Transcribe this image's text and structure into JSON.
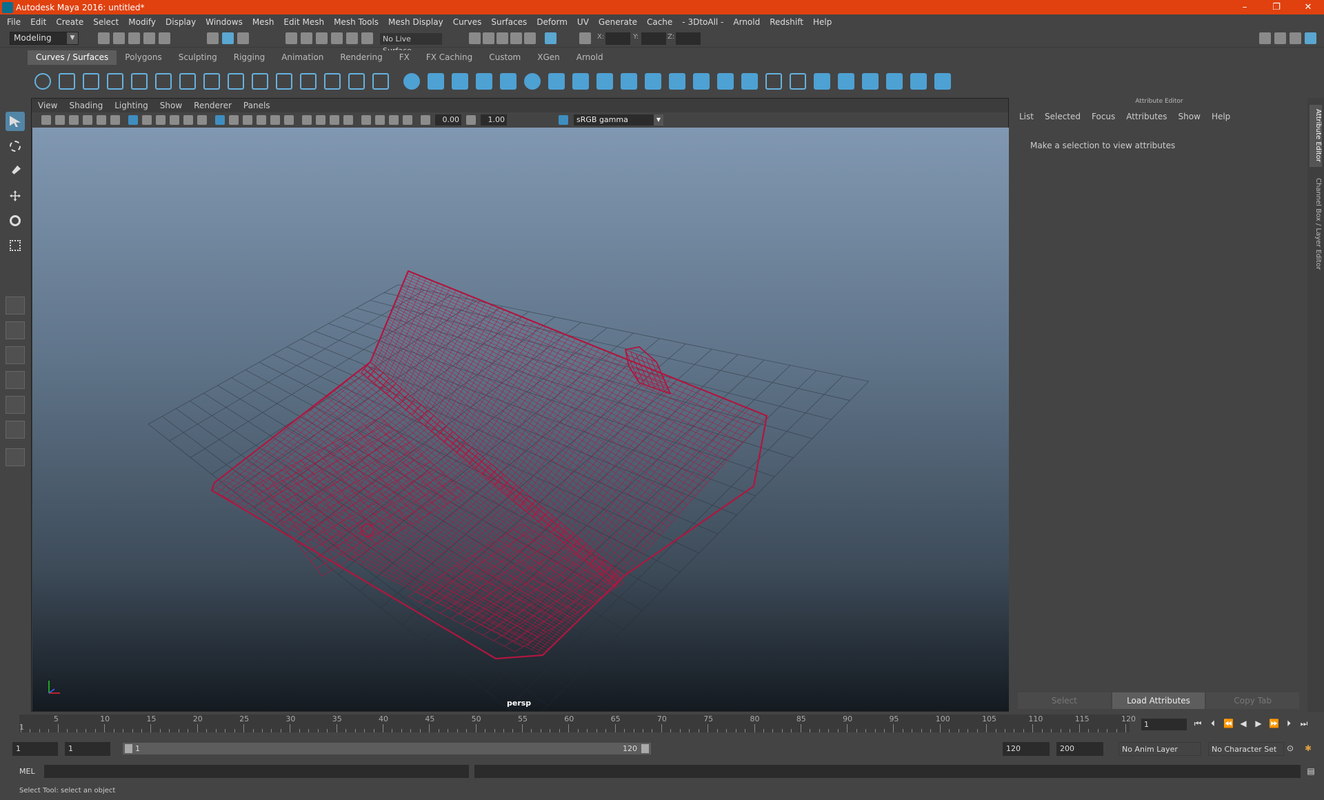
{
  "window": {
    "title": "Autodesk Maya 2016: untitled*",
    "minimize": "–",
    "maximize": "❐",
    "close": "✕"
  },
  "menu": [
    "File",
    "Edit",
    "Create",
    "Select",
    "Modify",
    "Display",
    "Windows",
    "Mesh",
    "Edit Mesh",
    "Mesh Tools",
    "Mesh Display",
    "Curves",
    "Surfaces",
    "Deform",
    "UV",
    "Generate",
    "Cache",
    "- 3DtoAll -",
    "Arnold",
    "Redshift",
    "Help"
  ],
  "status_line": {
    "mode": "Modeling",
    "live_surface": "No Live Surface",
    "x_label": "X:",
    "y_label": "Y:",
    "z_label": "Z:"
  },
  "shelf_tabs": [
    "Curves / Surfaces",
    "Polygons",
    "Sculpting",
    "Rigging",
    "Animation",
    "Rendering",
    "FX",
    "FX Caching",
    "Custom",
    "XGen",
    "Arnold"
  ],
  "shelf_active": "Curves / Surfaces",
  "panel_menu": [
    "View",
    "Shading",
    "Lighting",
    "Show",
    "Renderer",
    "Panels"
  ],
  "panel_toolbar": {
    "exposure": "0.00",
    "gamma": "1.00",
    "color_space": "sRGB gamma"
  },
  "viewport": {
    "camera": "persp",
    "wire_color": "#b0163f"
  },
  "attribute_editor": {
    "header": "Attribute Editor",
    "menu": [
      "List",
      "Selected",
      "Focus",
      "Attributes",
      "Show",
      "Help"
    ],
    "message": "Make a selection to view attributes",
    "buttons": {
      "select": "Select",
      "load": "Load Attributes",
      "copy": "Copy Tab"
    }
  },
  "side_tabs": {
    "attribute_editor": "Attribute Editor",
    "channel_box": "Channel Box / Layer Editor"
  },
  "time_slider": {
    "ticks": [
      "1",
      "5",
      "10",
      "15",
      "20",
      "25",
      "30",
      "35",
      "40",
      "45",
      "50",
      "55",
      "60",
      "65",
      "70",
      "75",
      "80",
      "85",
      "90",
      "95",
      "100",
      "105",
      "110",
      "115",
      "120"
    ],
    "current_frame": "1"
  },
  "range_slider": {
    "start": "1",
    "playback_start": "1",
    "slider_start": "1",
    "slider_end": "120",
    "playback_end": "120",
    "end": "200",
    "anim_layer": "No Anim Layer",
    "character_set": "No Character Set"
  },
  "command_line": {
    "label": "MEL"
  },
  "help_line": "Select Tool: select an object",
  "colors": {
    "title_bar": "#e0410f",
    "accent": "#5285a6",
    "shelf_icon": "#4ea1d3"
  }
}
